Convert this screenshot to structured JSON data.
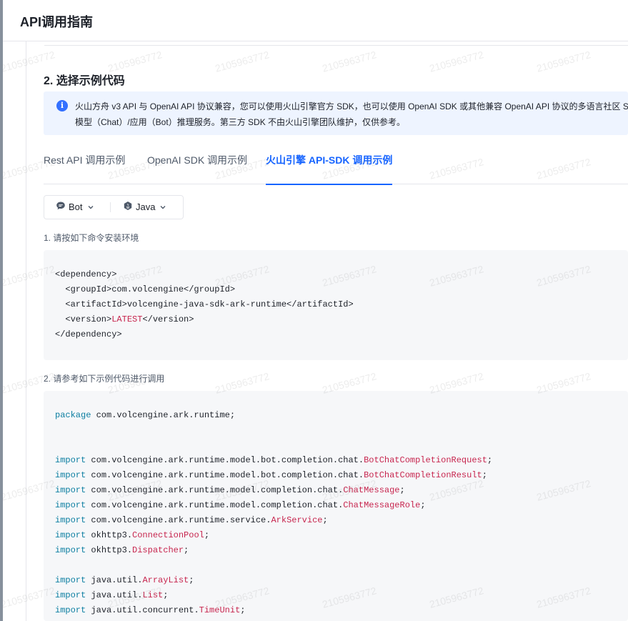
{
  "header": {
    "title": "API调用指南"
  },
  "section": {
    "title": "2. 选择示例代码"
  },
  "info": {
    "icon": "info-icon",
    "line1": "火山方舟 v3 API 与 OpenAI API 协议兼容，您可以使用火山引擎官方 SDK，也可以使用 OpenAI SDK 或其他兼容 OpenAI API 协议的多语言社区 SDK",
    "line2": "模型（Chat）/应用（Bot）推理服务。第三方 SDK 不由火山引擎团队维护，仅供参考。"
  },
  "tabs": [
    {
      "label": "Rest API 调用示例",
      "active": false
    },
    {
      "label": "OpenAI SDK 调用示例",
      "active": false
    },
    {
      "label": "火山引擎 API-SDK 调用示例",
      "active": true
    }
  ],
  "selectors": {
    "type": {
      "label": "Bot",
      "icon": "chat-bubble-icon"
    },
    "language": {
      "label": "Java",
      "icon": "java-icon"
    }
  },
  "steps": {
    "install_label": "1. 请按如下命令安装环境",
    "usage_label": "2. 请参考如下示例代码进行调用"
  },
  "install_code": [
    "<dependency>",
    "  <groupId>com.volcengine</groupId>",
    "  <artifactId>volcengine-java-sdk-ark-runtime</artifactId>",
    "  <version>LATEST</version>",
    "</dependency>"
  ],
  "usage_code": [
    {
      "kw": "package",
      "path": "com.volcengine.ark.runtime",
      "cls": ""
    },
    {
      "kw": "",
      "path": "",
      "cls": ""
    },
    {
      "kw": "",
      "path": "",
      "cls": ""
    },
    {
      "kw": "import",
      "path": "com.volcengine.ark.runtime.model.bot.completion.chat.",
      "cls": "BotChatCompletionRequest"
    },
    {
      "kw": "import",
      "path": "com.volcengine.ark.runtime.model.bot.completion.chat.",
      "cls": "BotChatCompletionResult"
    },
    {
      "kw": "import",
      "path": "com.volcengine.ark.runtime.model.completion.chat.",
      "cls": "ChatMessage"
    },
    {
      "kw": "import",
      "path": "com.volcengine.ark.runtime.model.completion.chat.",
      "cls": "ChatMessageRole"
    },
    {
      "kw": "import",
      "path": "com.volcengine.ark.runtime.service.",
      "cls": "ArkService"
    },
    {
      "kw": "import",
      "path": "okhttp3.",
      "cls": "ConnectionPool"
    },
    {
      "kw": "import",
      "path": "okhttp3.",
      "cls": "Dispatcher"
    },
    {
      "kw": "",
      "path": "",
      "cls": ""
    },
    {
      "kw": "import",
      "path": "java.util.",
      "cls": "ArrayList"
    },
    {
      "kw": "import",
      "path": "java.util.",
      "cls": "List"
    },
    {
      "kw": "import",
      "path": "java.util.concurrent.",
      "cls": "TimeUnit"
    }
  ],
  "watermark": {
    "text": "2105963772"
  },
  "colors": {
    "accent": "#1664ff",
    "info_bg": "#eef4ff",
    "code_bg": "#f6f7f9",
    "keyword": "#0b7ea1",
    "class": "#c7254e"
  }
}
